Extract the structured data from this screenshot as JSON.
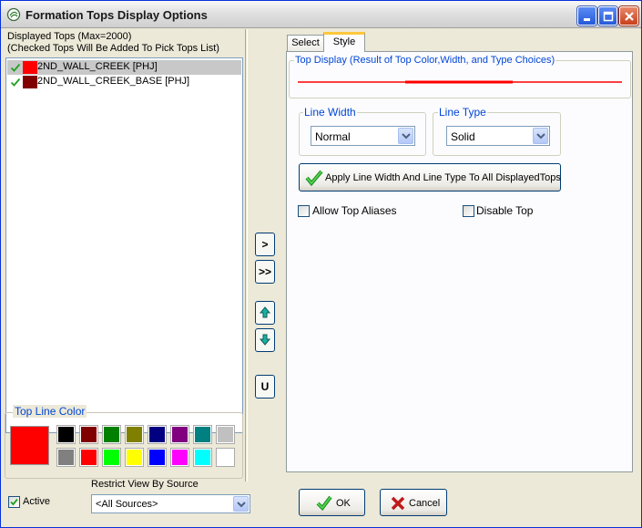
{
  "window": {
    "title": "Formation Tops Display Options"
  },
  "left": {
    "displayed_label_line1": "Displayed Tops (Max=2000)",
    "displayed_label_line2": "(Checked Tops Will Be Added To Pick Tops List)",
    "tops": [
      {
        "name": "2ND_WALL_CREEK [PHJ]",
        "color": "#ff0000",
        "checked": true,
        "selected": true
      },
      {
        "name": "2ND_WALL_CREEK_BASE [PHJ]",
        "color": "#800000",
        "checked": true,
        "selected": false
      }
    ],
    "top_line_color_label": "Top Line Color",
    "current_color": "#ff0000",
    "palette": [
      "#000000",
      "#800000",
      "#008000",
      "#808000",
      "#000080",
      "#800080",
      "#008080",
      "#c0c0c0",
      "#808080",
      "#ff0000",
      "#00ff00",
      "#ffff00",
      "#0000ff",
      "#ff00ff",
      "#00ffff",
      "#ffffff"
    ]
  },
  "bottom": {
    "active_label": "Active",
    "restrict_label": "Restrict View By Source",
    "source_value": "<All Sources>",
    "ok_label": "OK",
    "cancel_label": "Cancel"
  },
  "middle_buttons": {
    "add": ">",
    "add_all": ">>",
    "uncheck": "U"
  },
  "tabs": {
    "select": "Select",
    "style": "Style"
  },
  "style": {
    "top_display_label": "Top Display (Result of Top Color,Width, and Type Choices)",
    "line_width_label": "Line Width",
    "line_width_value": "Normal",
    "line_type_label": "Line Type",
    "line_type_value": "Solid",
    "apply_label": "Apply Line Width And Line Type To All DisplayedTops",
    "allow_aliases_label": "Allow Top Aliases",
    "disable_top_label": "Disable Top",
    "line_color": "#ff0000"
  }
}
